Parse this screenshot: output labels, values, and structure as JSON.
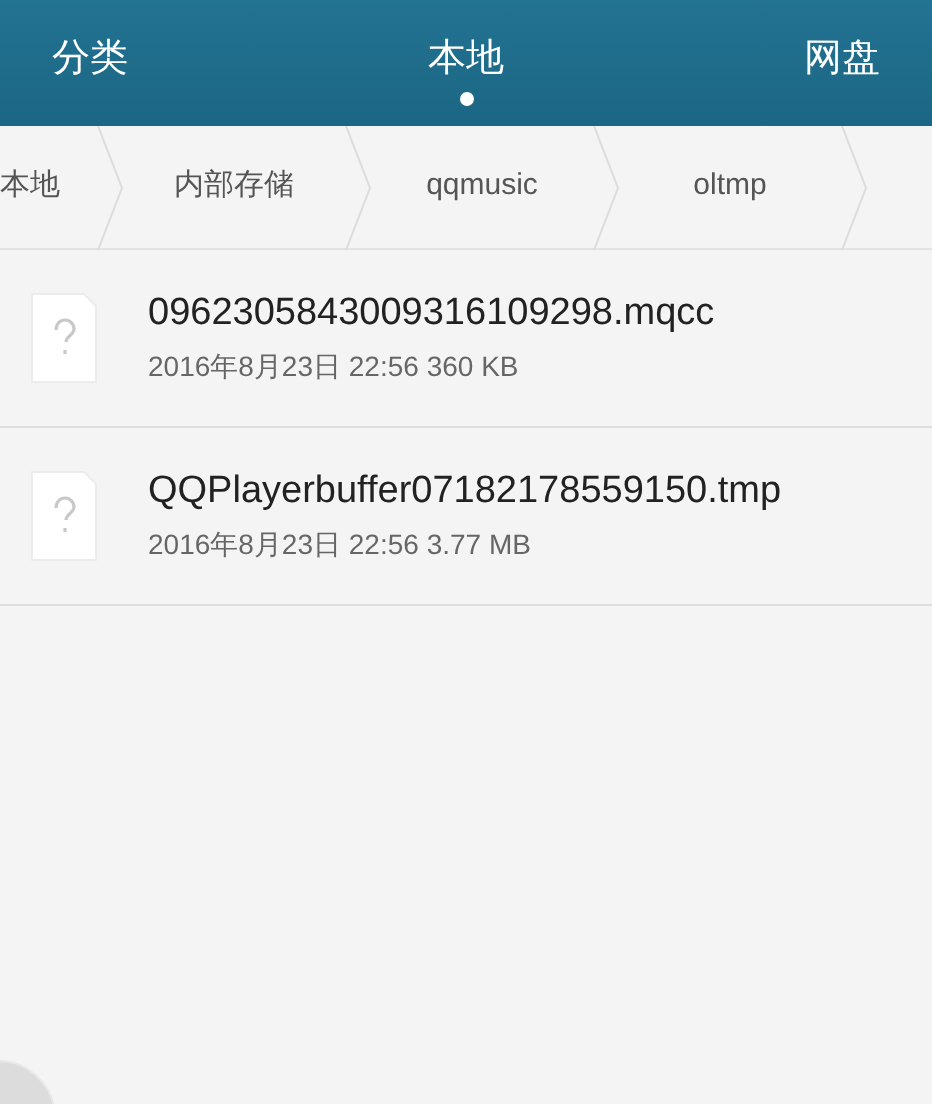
{
  "tabs": [
    {
      "label": "分类",
      "selected": false
    },
    {
      "label": "本地",
      "selected": true
    },
    {
      "label": "网盘",
      "selected": false
    }
  ],
  "breadcrumb": [
    "本地",
    "内部存储",
    "qqmusic",
    "oltmp"
  ],
  "files": [
    {
      "name": "0962305843009316109298.mqcc",
      "meta": "2016年8月23日 22:56 360 KB"
    },
    {
      "name": "QQPlayerbuffer07182178559150.tmp",
      "meta": "2016年8月23日 22:56 3.77 MB"
    }
  ]
}
